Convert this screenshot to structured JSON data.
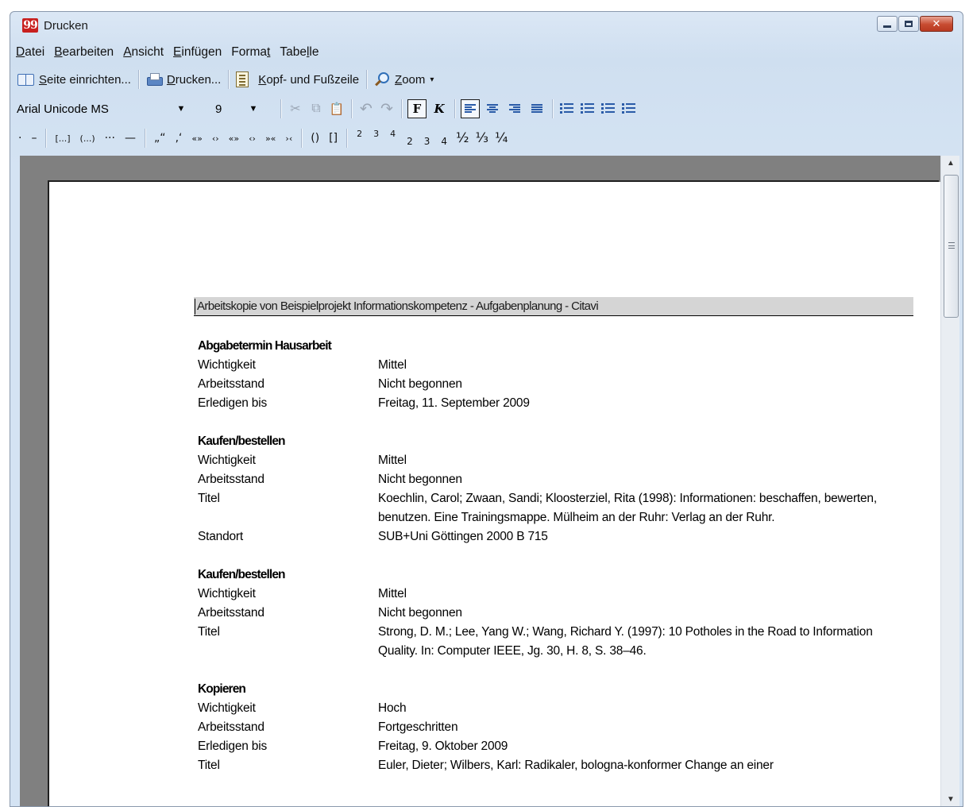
{
  "window": {
    "title": "Drucken",
    "app_icon": "citavi-quote-icon",
    "app_icon_glyph": "99",
    "controls": {
      "minimize": "minimize-icon",
      "maximize": "maximize-icon",
      "close": "close-icon",
      "close_glyph": "✕"
    }
  },
  "menu": {
    "items": [
      {
        "u": "D",
        "rest": "atei"
      },
      {
        "u": "B",
        "rest": "earbeiten"
      },
      {
        "u": "A",
        "rest": "nsicht"
      },
      {
        "u": "E",
        "rest": "infügen"
      },
      {
        "pre": "Forma",
        "u": "t",
        "rest": ""
      },
      {
        "pre": "Tabe",
        "u": "l",
        "rest": "le"
      }
    ]
  },
  "toolbar1": {
    "page_setup": {
      "u": "S",
      "rest": "eite einrichten..."
    },
    "print": {
      "u": "D",
      "rest": "rucken..."
    },
    "header_footer": {
      "u": "K",
      "rest": "opf- und Fußzeile"
    },
    "zoom": {
      "u": "Z",
      "rest": "oom"
    },
    "zoom_chevron": "▾"
  },
  "toolbar2": {
    "font": "Arial Unicode MS",
    "size": "9",
    "dropdown_arrow": "▼",
    "cut": "✂",
    "copy": "⧉",
    "paste": "📋",
    "undo": "↶",
    "redo": "↷",
    "bold": "F",
    "italic": "K"
  },
  "toolbar3": {
    "symbols": [
      "·",
      "–",
      "[...]",
      "(...)",
      "···",
      "—",
      "„“",
      "‚‘",
      "«»",
      "‹›",
      "«»",
      "‹›",
      "»«",
      "›‹",
      "()",
      "[]"
    ],
    "superscripts": [
      "2",
      "3",
      "4"
    ],
    "subscripts": [
      "2",
      "3",
      "4"
    ],
    "fractions": [
      "½",
      "⅓",
      "¼"
    ]
  },
  "document": {
    "header": "Arbeitskopie von Beispielprojekt Informationskompetenz - Aufgabenplanung - Citavi",
    "tasks": [
      {
        "title": "Abgabetermin Hausarbeit",
        "fields": [
          {
            "label": "Wichtigkeit",
            "value": "Mittel"
          },
          {
            "label": "Arbeitsstand",
            "value": "Nicht begonnen"
          },
          {
            "label": "Erledigen bis",
            "value": "Freitag, 11. September 2009"
          }
        ]
      },
      {
        "title": "Kaufen/bestellen",
        "fields": [
          {
            "label": "Wichtigkeit",
            "value": "Mittel"
          },
          {
            "label": "Arbeitsstand",
            "value": "Nicht begonnen"
          },
          {
            "label": "Titel",
            "value": "Koechlin, Carol; Zwaan, Sandi; Kloosterziel, Rita (1998): Informationen: beschaffen, bewerten, benutzen. Eine Trainingsmappe. Mülheim an der Ruhr: Verlag an der Ruhr."
          },
          {
            "label": "Standort",
            "value": "SUB+Uni Göttingen 2000 B 715"
          }
        ]
      },
      {
        "title": "Kaufen/bestellen",
        "fields": [
          {
            "label": "Wichtigkeit",
            "value": "Mittel"
          },
          {
            "label": "Arbeitsstand",
            "value": "Nicht begonnen"
          },
          {
            "label": "Titel",
            "value": "Strong, D. M.; Lee, Yang W.; Wang, Richard Y. (1997): 10 Potholes in the Road to Information Quality. In: Computer IEEE, Jg. 30, H. 8, S. 38–46."
          }
        ]
      },
      {
        "title": "Kopieren",
        "fields": [
          {
            "label": "Wichtigkeit",
            "value": "Hoch"
          },
          {
            "label": "Arbeitsstand",
            "value": "Fortgeschritten"
          },
          {
            "label": "Erledigen bis",
            "value": "Freitag, 9. Oktober 2009"
          },
          {
            "label": "Titel",
            "value": "Euler, Dieter; Wilbers, Karl: Radikaler, bologna-konformer Change an einer"
          }
        ]
      }
    ]
  },
  "scrollbar": {
    "up": "▲",
    "down": "▼"
  }
}
